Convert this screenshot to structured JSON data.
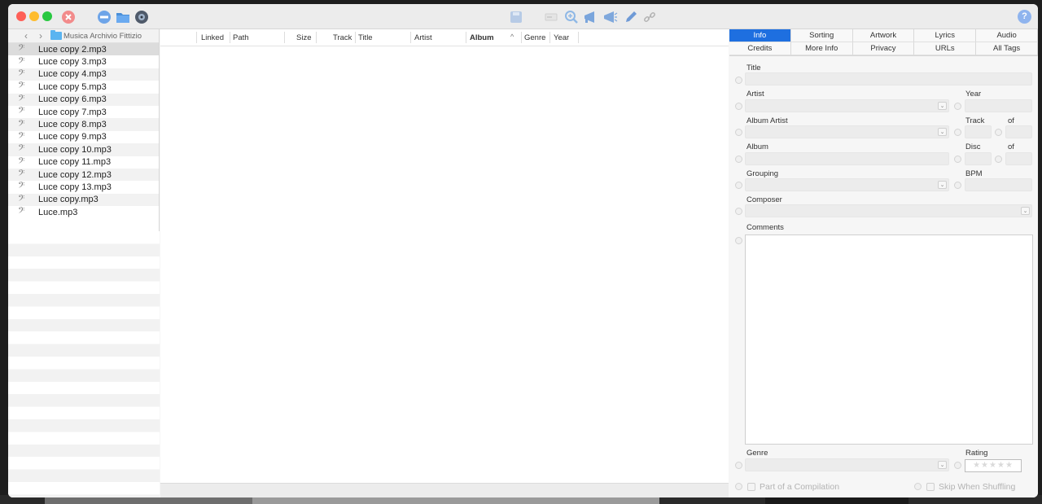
{
  "toolbar": {
    "icons": [
      "close-circle-icon",
      "remove-icon",
      "folder-icon",
      "disc-icon",
      "save-icon",
      "tag-icon",
      "zoom-icon",
      "megaphone-icon",
      "megaphone-alt-icon",
      "pencil-icon",
      "link-icon"
    ],
    "help_label": "?"
  },
  "sidebar": {
    "folder_name": "Musica Archivio Fittizio",
    "back_label": "‹",
    "forward_label": "›",
    "files": [
      "Luce copy 2.mp3",
      "Luce copy 3.mp3",
      "Luce copy 4.mp3",
      "Luce copy 5.mp3",
      "Luce copy 6.mp3",
      "Luce copy 7.mp3",
      "Luce copy 8.mp3",
      "Luce copy 9.mp3",
      "Luce copy 10.mp3",
      "Luce copy 11.mp3",
      "Luce copy 12.mp3",
      "Luce copy 13.mp3",
      "Luce copy.mp3",
      "Luce.mp3"
    ],
    "selected_index": 0
  },
  "table": {
    "columns": [
      "Linked",
      "Path",
      "Size",
      "Track",
      "Title",
      "Artist",
      "Album",
      "Genre",
      "Year"
    ],
    "sorted_column": "Album",
    "sort_indicator": "^"
  },
  "inspector": {
    "tabs_row1": [
      "Info",
      "Sorting",
      "Artwork",
      "Lyrics",
      "Audio"
    ],
    "tabs_row2": [
      "Credits",
      "More Info",
      "Privacy",
      "URLs",
      "All Tags"
    ],
    "active_tab": "Info",
    "labels": {
      "title": "Title",
      "artist": "Artist",
      "year": "Year",
      "album_artist": "Album Artist",
      "track": "Track",
      "track_of": "of",
      "album": "Album",
      "disc": "Disc",
      "disc_of": "of",
      "grouping": "Grouping",
      "bpm": "BPM",
      "composer": "Composer",
      "comments": "Comments",
      "genre": "Genre",
      "rating": "Rating",
      "compilation": "Part of a Compilation",
      "skip_shuffling": "Skip When Shuffling"
    },
    "rating_stars": "★★★★★",
    "dropdown_glyph": "⌄"
  },
  "colors": {
    "accent": "#1e6fe0",
    "window_bg": "#f6f6f6",
    "row_alt": "#f2f2f2"
  }
}
